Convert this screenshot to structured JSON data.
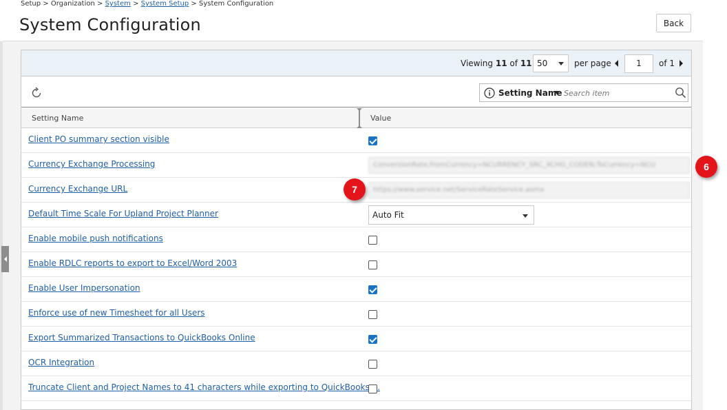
{
  "breadcrumb": {
    "setup": "Setup",
    "organization": "Organization",
    "system": "System",
    "system_setup": "System Setup",
    "current": "System Configuration",
    "sep": ">"
  },
  "page_title": "System Configuration",
  "back_label": "Back",
  "pager": {
    "viewing_label": "Viewing",
    "viewing_count": "11",
    "of_label": "of",
    "viewing_total": "11",
    "page_size": "50",
    "per_page_label": "per page",
    "current_page": "1",
    "page_total_label": "of 1"
  },
  "search": {
    "field": "Setting Name",
    "placeholder": "Search item"
  },
  "columns": {
    "setting_name": "Setting Name",
    "value": "Value"
  },
  "rows": [
    {
      "name": "Client PO summary section visible",
      "type": "checkbox",
      "checked": true
    },
    {
      "name": "Currency Exchange Processing",
      "type": "text",
      "value": "ConversionRate;fromCurrency=NCURRENCY_SRC_XCHG_CODEN;ToCurrency=NCU"
    },
    {
      "name": "Currency Exchange URL",
      "type": "text",
      "value": "https://www.service.net/ServiceRateService.asmx"
    },
    {
      "name": "Default Time Scale For Upland Project Planner",
      "type": "select",
      "value": "Auto Fit"
    },
    {
      "name": "Enable mobile push notifications",
      "type": "checkbox",
      "checked": false
    },
    {
      "name": "Enable RDLC reports to export to Excel/Word 2003",
      "type": "checkbox",
      "checked": false
    },
    {
      "name": "Enable User Impersonation",
      "type": "checkbox",
      "checked": true
    },
    {
      "name": "Enforce use of new Timesheet for all Users",
      "type": "checkbox",
      "checked": false
    },
    {
      "name": "Export Summarized Transactions to QuickBooks Online",
      "type": "checkbox",
      "checked": true
    },
    {
      "name": "OCR Integration",
      "type": "checkbox",
      "checked": false
    },
    {
      "name": "Truncate Client and Project Names to 41 characters while exporting to QuickBooks ...",
      "type": "checkbox",
      "checked": false
    }
  ],
  "callouts": {
    "six": "6",
    "seven": "7"
  },
  "colors": {
    "link": "#1f5fa8",
    "checkbox_checked": "#1a73c9",
    "pager_bg": "#eaf1f7",
    "callout": "#e4141b"
  }
}
